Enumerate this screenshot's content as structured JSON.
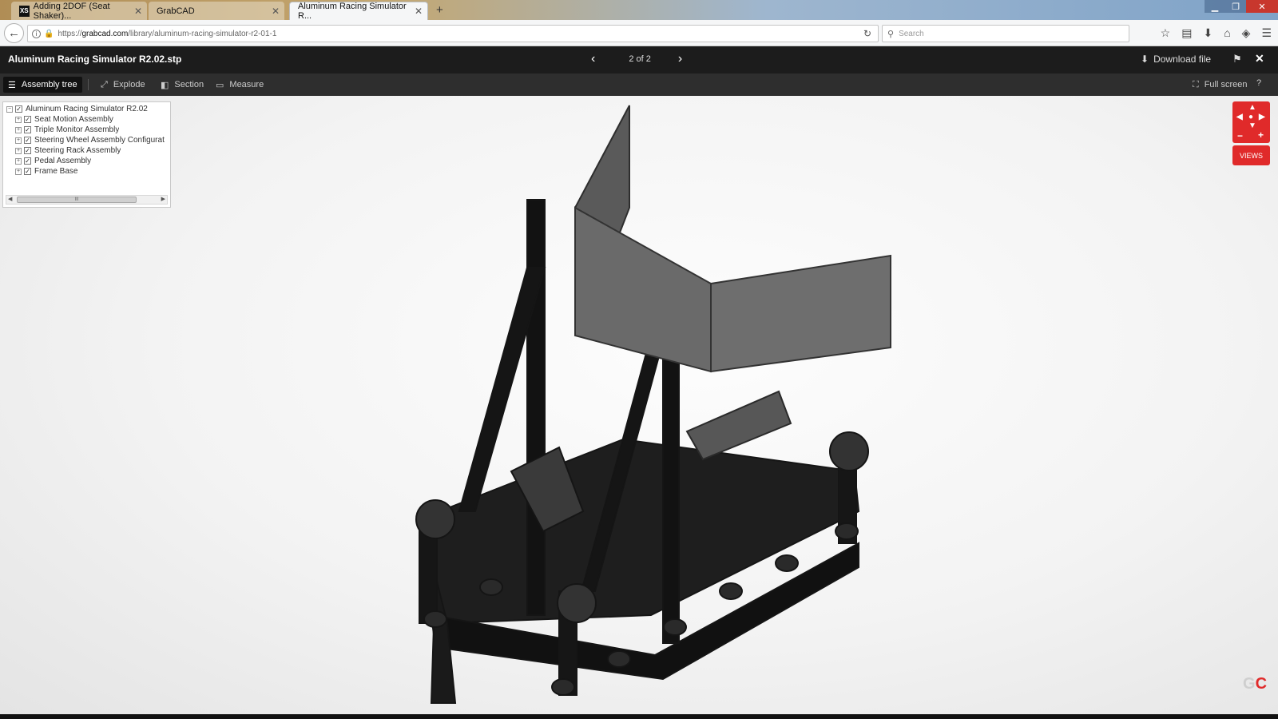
{
  "browser": {
    "tabs": [
      {
        "label": "Adding 2DOF (Seat Shaker)...",
        "favicon": "XS"
      },
      {
        "label": "GrabCAD"
      },
      {
        "label": "Aluminum Racing Simulator R..."
      }
    ],
    "new_tab_label": "+",
    "url_prefix": "https://",
    "url_host": "grabcad.com",
    "url_path": "/library/aluminum-racing-simulator-r2-01-1",
    "search_placeholder": "Search"
  },
  "viewer": {
    "file_title": "Aluminum Racing Simulator R2.02.stp",
    "pager_text": "2 of 2",
    "download_label": "Download file",
    "toolbar": {
      "assembly_tree": "Assembly tree",
      "explode": "Explode",
      "section": "Section",
      "measure": "Measure",
      "full_screen": "Full screen",
      "help": "?"
    },
    "views_label": "VIEWS",
    "logo": {
      "g": "G",
      "c": "C"
    }
  },
  "assembly_tree": {
    "root": "Aluminum Racing Simulator R2.02",
    "children": [
      "Seat Motion Assembly",
      "Triple Monitor Assembly",
      "Steering Wheel Assembly Configurat",
      "Steering Rack Assembly",
      "Pedal Assembly",
      "Frame Base"
    ],
    "scroll_thumb_label": "III"
  },
  "colors": {
    "accent_red": "#e02a2a",
    "header_bg": "#1c1c1c",
    "toolbar_bg": "#2e2e2e"
  },
  "icons": [
    "back-arrow-icon",
    "info-icon",
    "lock-icon",
    "reload-icon",
    "search-icon",
    "bookmark-star-icon",
    "reading-list-icon",
    "download-icon",
    "home-icon",
    "pocket-icon",
    "menu-icon",
    "prev-arrow-icon",
    "next-arrow-icon",
    "flag-icon",
    "close-icon",
    "tree-list-icon",
    "explode-icon",
    "section-icon",
    "ruler-icon",
    "fullscreen-icon",
    "help-icon"
  ]
}
